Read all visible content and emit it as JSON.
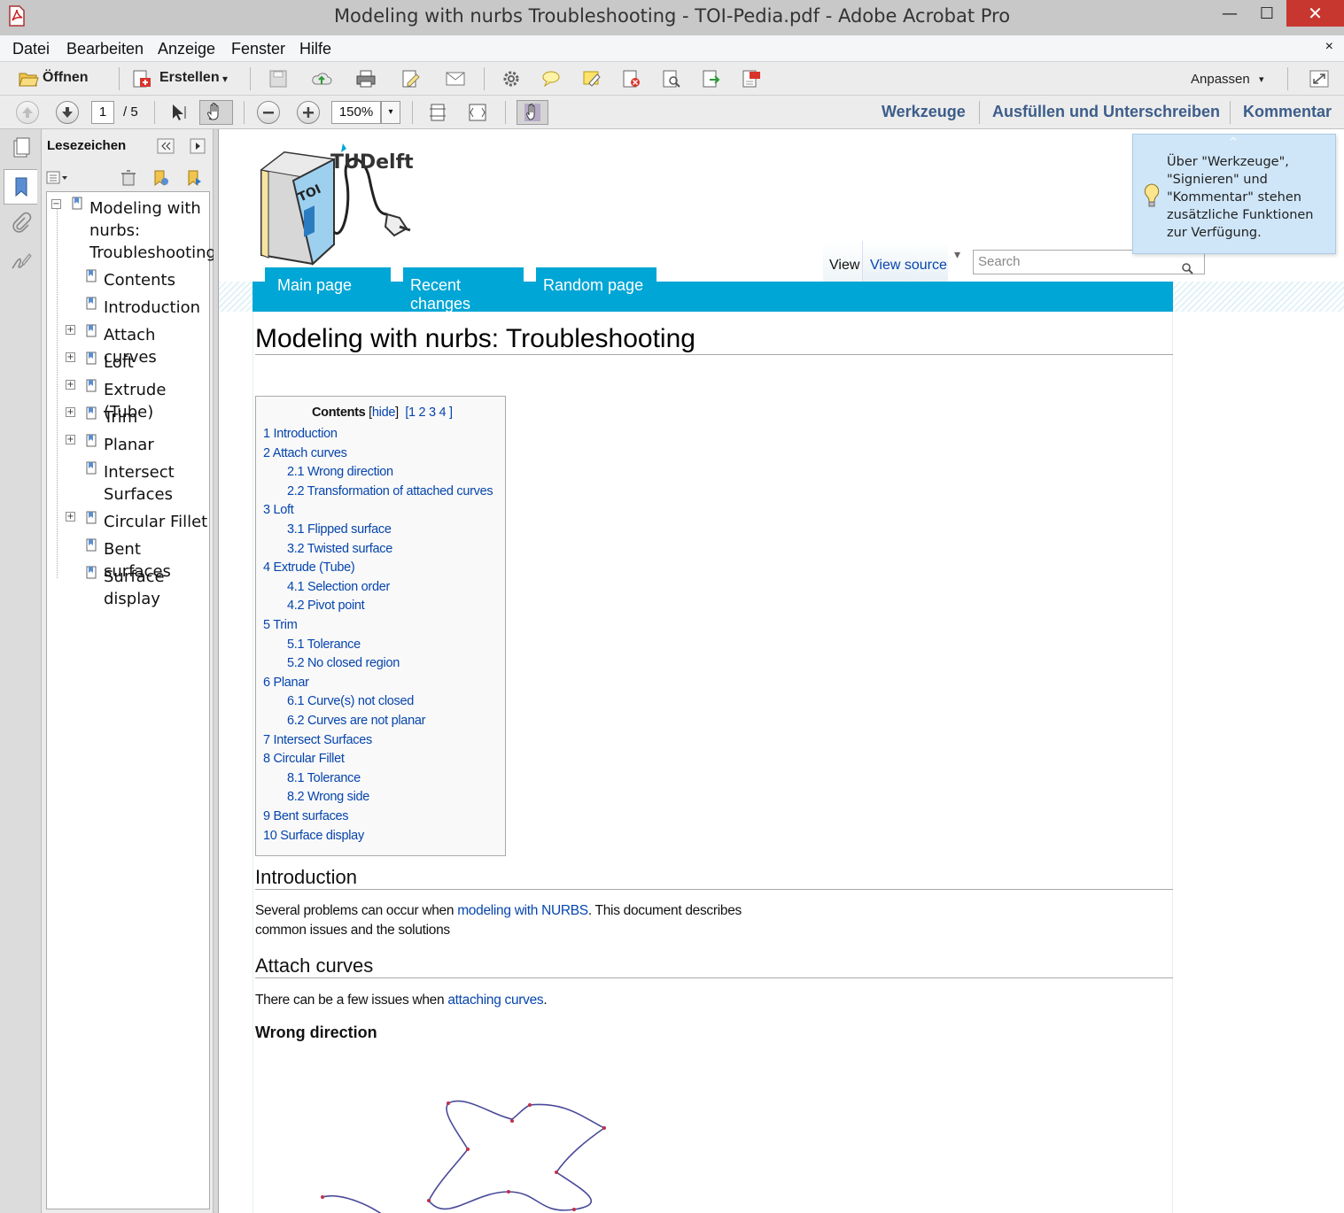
{
  "window": {
    "title": "Modeling with nurbs Troubleshooting - TOI-Pedia.pdf - Adobe Acrobat Pro",
    "minimize": "—",
    "maximize": "☐",
    "close": "✕"
  },
  "menubar": {
    "items": [
      "Datei",
      "Bearbeiten",
      "Anzeige",
      "Fenster",
      "Hilfe"
    ],
    "close": "×"
  },
  "toolbar1": {
    "open_label": "Öffnen",
    "create_label": "Erstellen",
    "create_arrow": "▾",
    "customize_label": "Anpassen",
    "customize_arrow": "▾"
  },
  "toolbar2": {
    "page_current": "1",
    "page_total": "/  5",
    "zoom": "150%",
    "zoom_arrow": "▾",
    "pane_links": [
      "Werkzeuge",
      "Ausfüllen und Unterschreiben",
      "Kommentar"
    ]
  },
  "bookmarks": {
    "title": "Lesezeichen",
    "items": [
      {
        "label": "Modeling with nurbs: Troubleshooting",
        "expand": "−"
      },
      {
        "label": "Contents",
        "expand": ""
      },
      {
        "label": "Introduction",
        "expand": ""
      },
      {
        "label": "Attach curves",
        "expand": "+"
      },
      {
        "label": "Loft",
        "expand": "+"
      },
      {
        "label": "Extrude (Tube)",
        "expand": "+"
      },
      {
        "label": "Trim",
        "expand": "+"
      },
      {
        "label": "Planar",
        "expand": "+"
      },
      {
        "label": "Intersect Surfaces",
        "expand": ""
      },
      {
        "label": "Circular Fillet",
        "expand": "+"
      },
      {
        "label": "Bent surfaces",
        "expand": ""
      },
      {
        "label": "Surface display",
        "expand": ""
      }
    ]
  },
  "tooltip": {
    "text": "Über \"Werkzeuge\", \"Signieren\" und \"Kommentar\" stehen zusätzliche Funktionen zur Verfügung.",
    "caret": "^"
  },
  "wiki": {
    "logo_text": "TUDelft",
    "book_text": "TOI",
    "nav_tabs": [
      "Main page",
      "Recent changes",
      "Random page"
    ],
    "view_tabs": [
      "View",
      "View source"
    ],
    "view_more": "▾",
    "search_placeholder": "Search",
    "page_title": "Modeling with nurbs: Troubleshooting",
    "toc": {
      "title": "Contents",
      "hide": "hide",
      "levels": "[1 2 3 4 ]",
      "entries": [
        {
          "text": "1 Introduction",
          "level": 1
        },
        {
          "text": "2 Attach curves",
          "level": 1
        },
        {
          "text": "2.1 Wrong direction",
          "level": 2
        },
        {
          "text": "2.2 Transformation of attached curves",
          "level": 2
        },
        {
          "text": "3 Loft",
          "level": 1
        },
        {
          "text": "3.1 Flipped surface",
          "level": 2
        },
        {
          "text": "3.2 Twisted surface",
          "level": 2
        },
        {
          "text": "4 Extrude (Tube)",
          "level": 1
        },
        {
          "text": "4.1 Selection order",
          "level": 2
        },
        {
          "text": "4.2 Pivot point",
          "level": 2
        },
        {
          "text": "5 Trim",
          "level": 1
        },
        {
          "text": "5.1 Tolerance",
          "level": 2
        },
        {
          "text": "5.2 No closed region",
          "level": 2
        },
        {
          "text": "6 Planar",
          "level": 1
        },
        {
          "text": "6.1 Curve(s) not closed",
          "level": 2
        },
        {
          "text": "6.2 Curves are not planar",
          "level": 2
        },
        {
          "text": "7 Intersect Surfaces",
          "level": 1
        },
        {
          "text": "8 Circular Fillet",
          "level": 1
        },
        {
          "text": "8.1 Tolerance",
          "level": 2
        },
        {
          "text": "8.2 Wrong side",
          "level": 2
        },
        {
          "text": "9 Bent surfaces",
          "level": 1
        },
        {
          "text": "10 Surface display",
          "level": 1
        }
      ]
    },
    "intro": {
      "heading": "Introduction",
      "text_before": "Several problems can occur when ",
      "link": "modeling with NURBS",
      "text_after": ". This document describes",
      "line2": "common issues and the solutions"
    },
    "attach": {
      "heading": "Attach curves",
      "text_before": "There can be a few issues when ",
      "link": "attaching curves",
      "text_after": "."
    },
    "wrong_direction": "Wrong direction"
  }
}
